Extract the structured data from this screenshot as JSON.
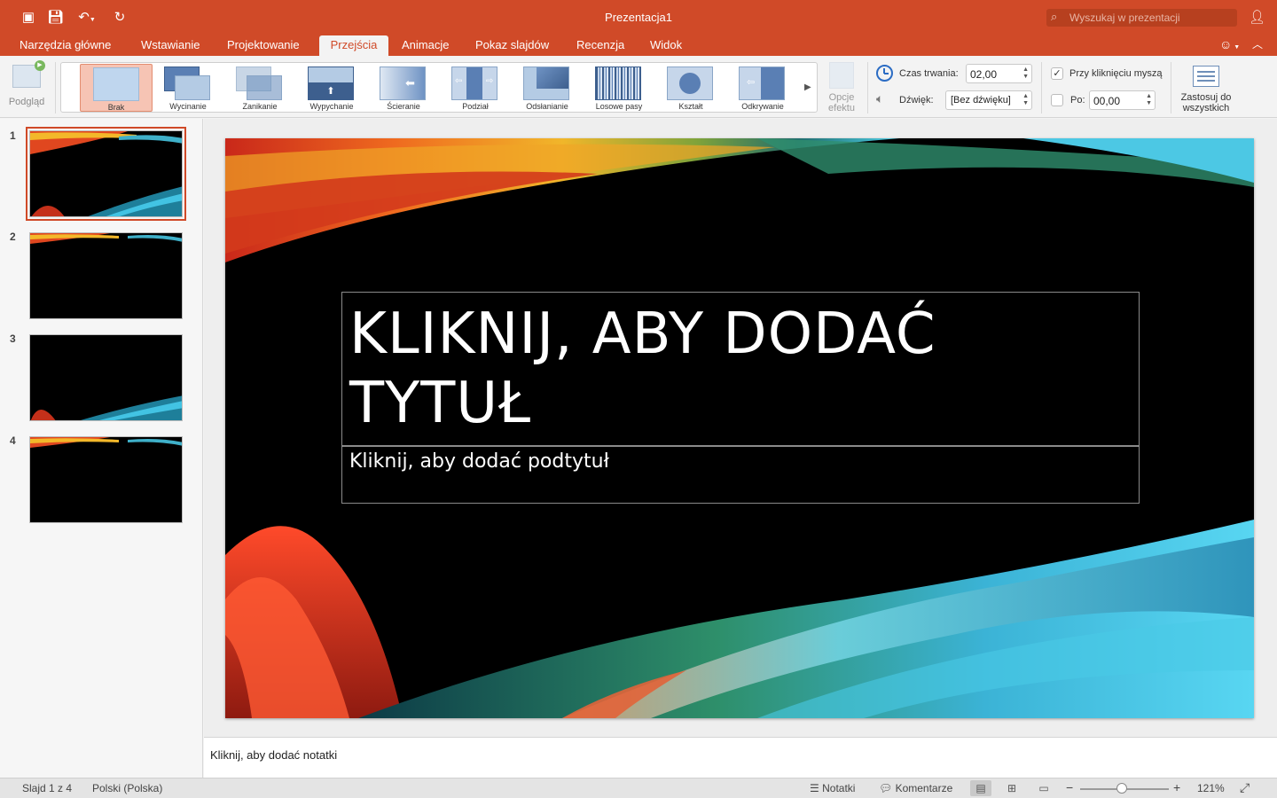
{
  "app": {
    "title": "Prezentacja1"
  },
  "search": {
    "placeholder": "Wyszukaj w prezentacji"
  },
  "titlebar_icons": [
    "sidebar-icon",
    "save-icon",
    "undo-icon",
    "redo-icon",
    "search-icon",
    "add-person-icon"
  ],
  "tabs": [
    {
      "label": "Narzędzia główne"
    },
    {
      "label": "Wstawianie"
    },
    {
      "label": "Projektowanie"
    },
    {
      "label": "Przejścia",
      "active": true
    },
    {
      "label": "Animacje"
    },
    {
      "label": "Pokaz slajdów"
    },
    {
      "label": "Recenzja"
    },
    {
      "label": "Widok"
    }
  ],
  "ribbon": {
    "preview_label": "Podgląd",
    "transitions": [
      {
        "label": "Brak",
        "selected": true
      },
      {
        "label": "Wycinanie"
      },
      {
        "label": "Zanikanie"
      },
      {
        "label": "Wypychanie"
      },
      {
        "label": "Ścieranie"
      },
      {
        "label": "Podział"
      },
      {
        "label": "Odsłanianie"
      },
      {
        "label": "Losowe pasy"
      },
      {
        "label": "Kształt"
      },
      {
        "label": "Odkrywanie"
      }
    ],
    "effect_options_line1": "Opcje",
    "effect_options_line2": "efektu",
    "duration_label": "Czas trwania:",
    "duration_value": "02,00",
    "sound_label": "Dźwięk:",
    "sound_value": "[Bez dźwięku]",
    "on_click_label": "Przy kliknięciu myszą",
    "on_click_checked": true,
    "after_label": "Po:",
    "after_value": "00,00",
    "after_checked": false,
    "apply_all_line1": "Zastosuj do",
    "apply_all_line2": "wszystkich"
  },
  "slides": [
    {
      "number": "1",
      "selected": true
    },
    {
      "number": "2"
    },
    {
      "number": "3"
    },
    {
      "number": "4"
    }
  ],
  "slide": {
    "title_line1": "KLIKNIJ, ABY DODAĆ",
    "title_line2": "TYTUŁ",
    "subtitle": "Kliknij, aby dodać podtytuł"
  },
  "notes": {
    "placeholder": "Kliknij, aby dodać notatki"
  },
  "status": {
    "slide_info": "Slajd 1 z 4",
    "language": "Polski (Polska)",
    "notes_label": "Notatki",
    "comments_label": "Komentarze",
    "zoom": "121%",
    "zoom_fraction": 0.47
  }
}
